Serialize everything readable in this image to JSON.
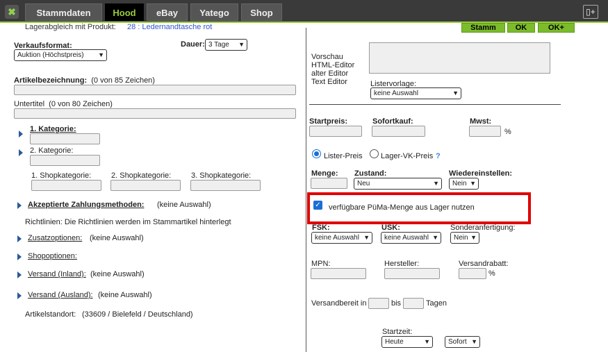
{
  "tabs": [
    {
      "label": "Stammdaten"
    },
    {
      "label": "Hood"
    },
    {
      "label": "eBay"
    },
    {
      "label": "Yatego"
    },
    {
      "label": "Shop"
    }
  ],
  "header": {
    "lager_label": "Lagerabgleich mit Produkt:",
    "lager_value": "28 : Ledernandtasche rot",
    "btn_stamm": "Stamm",
    "btn_ok": "OK",
    "btn_okplus": "OK+"
  },
  "left": {
    "verkaufsformat_label": "Verkaufsformat:",
    "verkaufsformat_value": "Auktion  (Höchstpreis)",
    "dauer_label": "Dauer:",
    "dauer_value": "3 Tage",
    "artikelbez_label": "Artikelbezeichnung:",
    "artikelbez_count": "(0 von 85 Zeichen)",
    "untertitel_label": "Untertitel",
    "untertitel_count": "(0 von 80 Zeichen)",
    "kat1": "1. Kategorie:",
    "kat2": "2. Kategorie:",
    "shopkat1": "1. Shopkategorie:",
    "shopkat2": "2. Shopkategorie:",
    "shopkat3": "3. Shopkategorie:",
    "zahlung_label": "Akzeptierte Zahlungsmethoden:",
    "zahlung_value": "(keine Auswahl)",
    "richtlinien": "Richtlinien: Die Richtlinien werden im Stammartikel hinterlegt",
    "zusatz_label": "Zusatzoptionen:",
    "zusatz_value": "(keine Auswahl)",
    "shopopt_label": "Shopoptionen:",
    "versand_inland_label": "Versand (Inland):",
    "versand_inland_value": "(keine Auswahl)",
    "versand_ausland_label": "Versand (Ausland):",
    "versand_ausland_value": "(keine Auswahl)",
    "standort_label": "Artikelstandort:",
    "standort_value": "(33609 / Bielefeld / Deutschland)"
  },
  "right": {
    "editor_links": [
      "Vorschau",
      "HTML-Editor",
      "alter Editor",
      "Text Editor"
    ],
    "listervorlage_label": "Listervorlage:",
    "listervorlage_value": "keine Auswahl",
    "startpreis_label": "Startpreis:",
    "sofortkauf_label": "Sofortkauf:",
    "mwst_label": "Mwst:",
    "mwst_unit": "%",
    "radio_lister": "Lister-Preis",
    "radio_lager": "Lager-VK-Preis",
    "help_mark": "?",
    "menge_label": "Menge:",
    "zustand_label": "Zustand:",
    "zustand_value": "Neu",
    "wiedereinstellen_label": "Wiedereinstellen:",
    "wiedereinstellen_value": "Nein",
    "checkbox_label": "verfügbare PüMa-Menge aus Lager nutzen",
    "fsk_label": "FSK:",
    "fsk_value": "keine Auswahl",
    "usk_label": "USK:",
    "usk_value": "keine Auswahl",
    "sonder_label": "Sonderanfertigung:",
    "sonder_value": "Nein",
    "mpn_label": "MPN:",
    "hersteller_label": "Hersteller:",
    "versandrabatt_label": "Versandrabatt:",
    "versandrabatt_unit": "%",
    "versandbereit_label": "Versandbereit in",
    "versandbereit_bis": "bis",
    "versandbereit_tagen": "Tagen",
    "startzeit_label": "Startzeit:",
    "startzeit_value": "Heute",
    "startzeit_mode": "Sofort"
  },
  "colors": {
    "tab_active_text": "#9bcc3a",
    "button_green": "#7cbb2c",
    "highlight_red": "#e00000",
    "link_blue": "#3355cc"
  }
}
